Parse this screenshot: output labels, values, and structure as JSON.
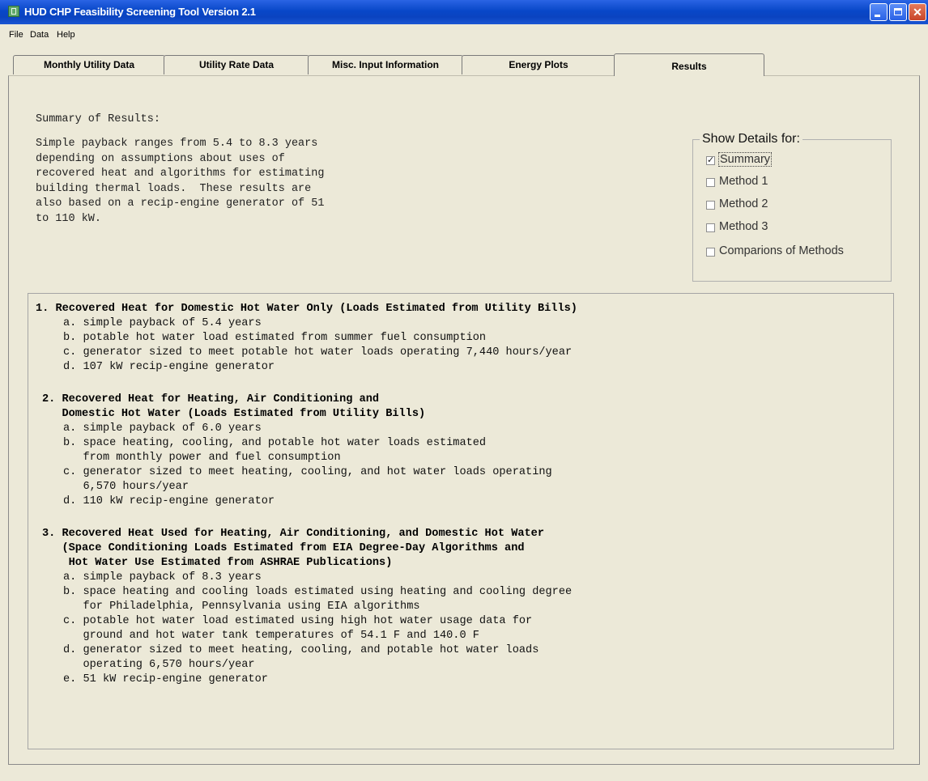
{
  "window": {
    "title": "HUD CHP Feasibility Screening Tool Version 2.1",
    "titlebar_color": "#0847c8",
    "close_glyph": "✕"
  },
  "menu": [
    "File",
    "Data",
    "Help"
  ],
  "tabs": [
    {
      "label": "Monthly Utility Data",
      "active": false
    },
    {
      "label": "Utility Rate Data",
      "active": false
    },
    {
      "label": "Misc. Input Information",
      "active": false
    },
    {
      "label": "Energy Plots",
      "active": false
    },
    {
      "label": "Results",
      "active": true
    }
  ],
  "summary": {
    "heading": "Summary of Results:",
    "lines": [
      "Simple payback ranges from 5.4 to 8.3 years",
      "depending on assumptions about uses of",
      "recovered heat and algorithms for estimating",
      "building thermal loads.  These results are",
      "also based on a recip-engine generator of 51",
      "to 110 kW."
    ]
  },
  "details": {
    "legend": "Show Details for:",
    "options": [
      {
        "label": "Summary",
        "checked": true,
        "focused": true
      },
      {
        "label": "Method 1",
        "checked": false,
        "focused": false
      },
      {
        "label": "Method 2",
        "checked": false,
        "focused": false
      },
      {
        "label": "Method 3",
        "checked": false,
        "focused": false
      },
      {
        "label": "Comparions of Methods",
        "checked": false,
        "focused": false
      }
    ],
    "check_glyph": "✓"
  },
  "results": {
    "method1": {
      "title": "1. Recovered Heat for Domestic Hot Water Only (Loads Estimated from Utility Bills)",
      "items": [
        "a. simple payback of 5.4 years",
        "b. potable hot water load estimated from summer fuel consumption",
        "c. generator sized to meet potable hot water loads operating 7,440 hours/year",
        "d. 107 kW recip-engine generator"
      ]
    },
    "method2": {
      "title": [
        "2. Recovered Heat for Heating, Air Conditioning and",
        "   Domestic Hot Water (Loads Estimated from Utility Bills)"
      ],
      "items": [
        "a. simple payback of 6.0 years",
        "b. space heating, cooling, and potable hot water loads estimated",
        "   from monthly power and fuel consumption",
        "c. generator sized to meet heating, cooling, and hot water loads operating",
        "   6,570 hours/year",
        "d. 110 kW recip-engine generator"
      ]
    },
    "method3": {
      "title": [
        "3. Recovered Heat Used for Heating, Air Conditioning, and Domestic Hot Water",
        "   (Space Conditioning Loads Estimated from EIA Degree-Day Algorithms and",
        "    Hot Water Use Estimated from ASHRAE Publications)"
      ],
      "items": [
        "a. simple payback of 8.3 years",
        "b. space heating and cooling loads estimated using heating and cooling degree",
        "   for Philadelphia, Pennsylvania using EIA algorithms",
        "c. potable hot water load estimated using high hot water usage data for",
        "   ground and hot water tank temperatures of 54.1 F and 140.0 F",
        "d. generator sized to meet heating, cooling, and potable hot water loads",
        "   operating 6,570 hours/year",
        "e. 51 kW recip-engine generator"
      ]
    }
  }
}
